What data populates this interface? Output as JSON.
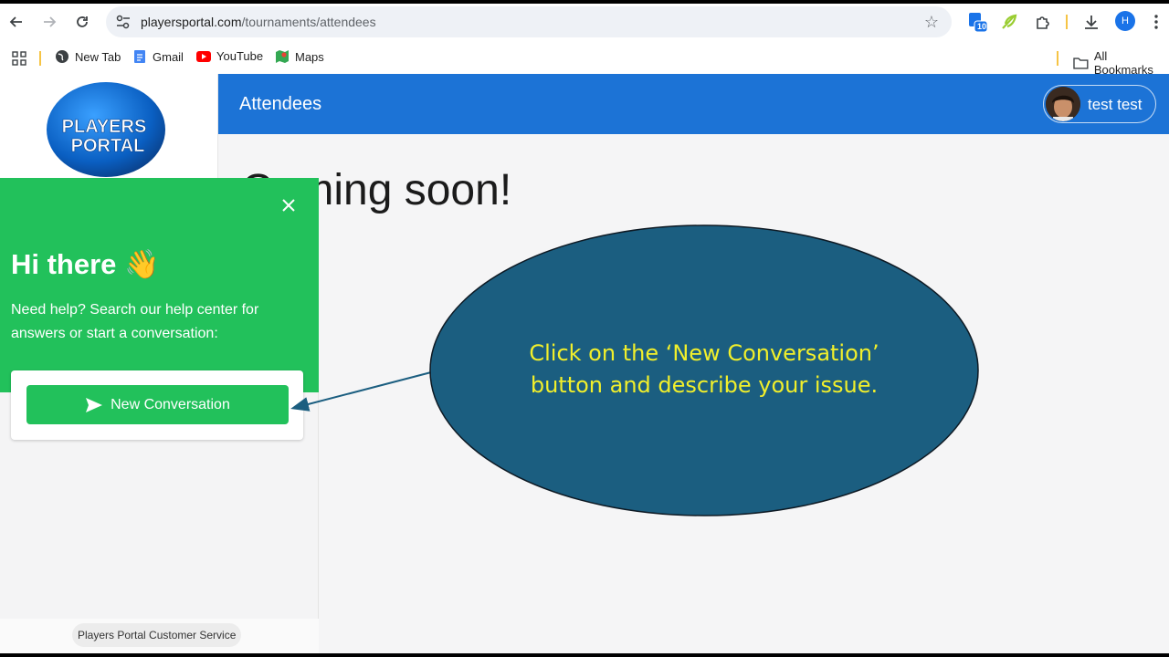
{
  "browser": {
    "url_host": "playersportal.com",
    "url_path": "/tournaments/attendees",
    "profile_initial": "H",
    "extension_badge": "10",
    "bookmarks": [
      {
        "label": "New Tab",
        "icon": "globe-icon"
      },
      {
        "label": "Gmail",
        "icon": "docs-icon"
      },
      {
        "label": "YouTube",
        "icon": "youtube-icon"
      },
      {
        "label": "Maps",
        "icon": "maps-icon"
      }
    ],
    "all_bookmarks_label": "All Bookmarks"
  },
  "app": {
    "logo_line1": "PLAYERS",
    "logo_line2": "PORTAL",
    "header_title": "Attendees",
    "user_name": "test test",
    "main_text": "Coming soon!",
    "colors": {
      "header": "#1c73d6",
      "widget": "#22c15b"
    }
  },
  "widget": {
    "greeting": "Hi there 👋",
    "help_text": "Need help? Search our help center for answers or start a conversation:",
    "new_conversation_label": "New Conversation",
    "footer_label": "Players Portal Customer Service"
  },
  "callout": {
    "line1": "Click on the ‘New Conversation’",
    "line2": "button and describe your issue.",
    "fill": "#1b5e80",
    "text_color": "#f1ef2b"
  }
}
